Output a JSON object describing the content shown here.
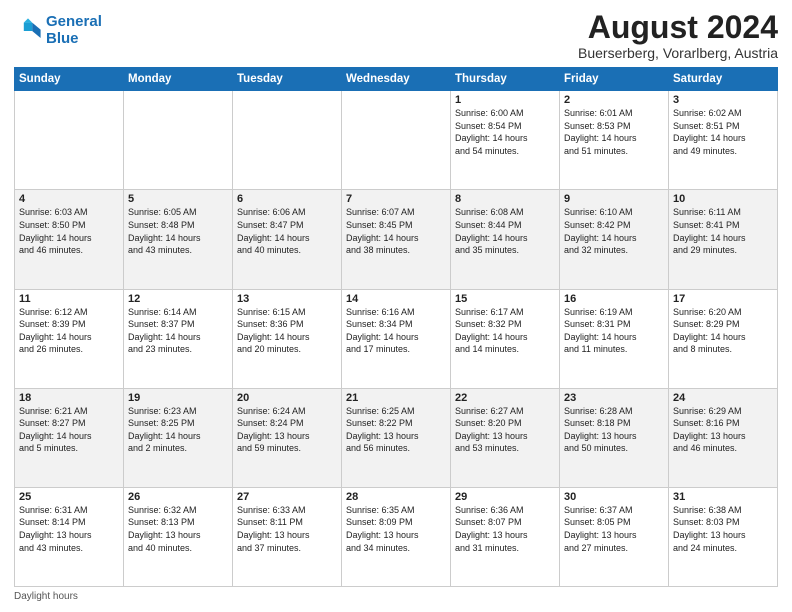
{
  "logo": {
    "line1": "General",
    "line2": "Blue"
  },
  "title": "August 2024",
  "subtitle": "Buerserberg, Vorarlberg, Austria",
  "days_of_week": [
    "Sunday",
    "Monday",
    "Tuesday",
    "Wednesday",
    "Thursday",
    "Friday",
    "Saturday"
  ],
  "footer": "Daylight hours",
  "weeks": [
    [
      {
        "day": "",
        "info": ""
      },
      {
        "day": "",
        "info": ""
      },
      {
        "day": "",
        "info": ""
      },
      {
        "day": "",
        "info": ""
      },
      {
        "day": "1",
        "info": "Sunrise: 6:00 AM\nSunset: 8:54 PM\nDaylight: 14 hours\nand 54 minutes."
      },
      {
        "day": "2",
        "info": "Sunrise: 6:01 AM\nSunset: 8:53 PM\nDaylight: 14 hours\nand 51 minutes."
      },
      {
        "day": "3",
        "info": "Sunrise: 6:02 AM\nSunset: 8:51 PM\nDaylight: 14 hours\nand 49 minutes."
      }
    ],
    [
      {
        "day": "4",
        "info": "Sunrise: 6:03 AM\nSunset: 8:50 PM\nDaylight: 14 hours\nand 46 minutes."
      },
      {
        "day": "5",
        "info": "Sunrise: 6:05 AM\nSunset: 8:48 PM\nDaylight: 14 hours\nand 43 minutes."
      },
      {
        "day": "6",
        "info": "Sunrise: 6:06 AM\nSunset: 8:47 PM\nDaylight: 14 hours\nand 40 minutes."
      },
      {
        "day": "7",
        "info": "Sunrise: 6:07 AM\nSunset: 8:45 PM\nDaylight: 14 hours\nand 38 minutes."
      },
      {
        "day": "8",
        "info": "Sunrise: 6:08 AM\nSunset: 8:44 PM\nDaylight: 14 hours\nand 35 minutes."
      },
      {
        "day": "9",
        "info": "Sunrise: 6:10 AM\nSunset: 8:42 PM\nDaylight: 14 hours\nand 32 minutes."
      },
      {
        "day": "10",
        "info": "Sunrise: 6:11 AM\nSunset: 8:41 PM\nDaylight: 14 hours\nand 29 minutes."
      }
    ],
    [
      {
        "day": "11",
        "info": "Sunrise: 6:12 AM\nSunset: 8:39 PM\nDaylight: 14 hours\nand 26 minutes."
      },
      {
        "day": "12",
        "info": "Sunrise: 6:14 AM\nSunset: 8:37 PM\nDaylight: 14 hours\nand 23 minutes."
      },
      {
        "day": "13",
        "info": "Sunrise: 6:15 AM\nSunset: 8:36 PM\nDaylight: 14 hours\nand 20 minutes."
      },
      {
        "day": "14",
        "info": "Sunrise: 6:16 AM\nSunset: 8:34 PM\nDaylight: 14 hours\nand 17 minutes."
      },
      {
        "day": "15",
        "info": "Sunrise: 6:17 AM\nSunset: 8:32 PM\nDaylight: 14 hours\nand 14 minutes."
      },
      {
        "day": "16",
        "info": "Sunrise: 6:19 AM\nSunset: 8:31 PM\nDaylight: 14 hours\nand 11 minutes."
      },
      {
        "day": "17",
        "info": "Sunrise: 6:20 AM\nSunset: 8:29 PM\nDaylight: 14 hours\nand 8 minutes."
      }
    ],
    [
      {
        "day": "18",
        "info": "Sunrise: 6:21 AM\nSunset: 8:27 PM\nDaylight: 14 hours\nand 5 minutes."
      },
      {
        "day": "19",
        "info": "Sunrise: 6:23 AM\nSunset: 8:25 PM\nDaylight: 14 hours\nand 2 minutes."
      },
      {
        "day": "20",
        "info": "Sunrise: 6:24 AM\nSunset: 8:24 PM\nDaylight: 13 hours\nand 59 minutes."
      },
      {
        "day": "21",
        "info": "Sunrise: 6:25 AM\nSunset: 8:22 PM\nDaylight: 13 hours\nand 56 minutes."
      },
      {
        "day": "22",
        "info": "Sunrise: 6:27 AM\nSunset: 8:20 PM\nDaylight: 13 hours\nand 53 minutes."
      },
      {
        "day": "23",
        "info": "Sunrise: 6:28 AM\nSunset: 8:18 PM\nDaylight: 13 hours\nand 50 minutes."
      },
      {
        "day": "24",
        "info": "Sunrise: 6:29 AM\nSunset: 8:16 PM\nDaylight: 13 hours\nand 46 minutes."
      }
    ],
    [
      {
        "day": "25",
        "info": "Sunrise: 6:31 AM\nSunset: 8:14 PM\nDaylight: 13 hours\nand 43 minutes."
      },
      {
        "day": "26",
        "info": "Sunrise: 6:32 AM\nSunset: 8:13 PM\nDaylight: 13 hours\nand 40 minutes."
      },
      {
        "day": "27",
        "info": "Sunrise: 6:33 AM\nSunset: 8:11 PM\nDaylight: 13 hours\nand 37 minutes."
      },
      {
        "day": "28",
        "info": "Sunrise: 6:35 AM\nSunset: 8:09 PM\nDaylight: 13 hours\nand 34 minutes."
      },
      {
        "day": "29",
        "info": "Sunrise: 6:36 AM\nSunset: 8:07 PM\nDaylight: 13 hours\nand 31 minutes."
      },
      {
        "day": "30",
        "info": "Sunrise: 6:37 AM\nSunset: 8:05 PM\nDaylight: 13 hours\nand 27 minutes."
      },
      {
        "day": "31",
        "info": "Sunrise: 6:38 AM\nSunset: 8:03 PM\nDaylight: 13 hours\nand 24 minutes."
      }
    ]
  ]
}
